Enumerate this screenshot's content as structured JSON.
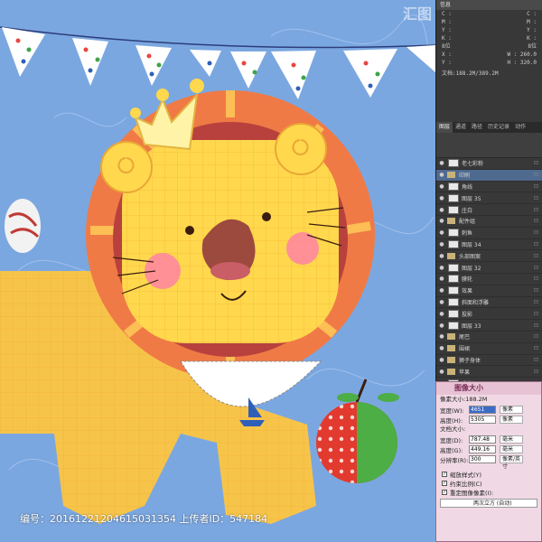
{
  "info": {
    "tab": "信息",
    "rows": [
      [
        "C :",
        "C :"
      ],
      [
        "M :",
        "M :"
      ],
      [
        "Y :",
        "Y :"
      ],
      [
        "K :",
        "K :"
      ],
      [
        "8位",
        "8位"
      ],
      [
        "X :",
        "W :   260.0"
      ],
      [
        "Y :",
        "H :   320.0"
      ]
    ],
    "doc": "文档:188.2M/389.2M"
  },
  "layers": {
    "tabs": [
      "图层",
      "通道",
      "路径",
      "历史记录",
      "动作"
    ],
    "items": [
      {
        "name": "老七彩粉",
        "type": "layer"
      },
      {
        "name": "印刷",
        "type": "group",
        "selected": true
      },
      {
        "name": "角线",
        "type": "layer"
      },
      {
        "name": "图层 35",
        "type": "layer"
      },
      {
        "name": "庄白",
        "type": "layer"
      },
      {
        "name": "配件组",
        "type": "group"
      },
      {
        "name": "刺鱼",
        "type": "layer"
      },
      {
        "name": "图层 34",
        "type": "layer"
      },
      {
        "name": "头部图案",
        "type": "group"
      },
      {
        "name": "图层 32",
        "type": "layer"
      },
      {
        "name": "膜轮",
        "type": "layer"
      },
      {
        "name": "效果",
        "type": "layer"
      },
      {
        "name": "斜面和浮雕",
        "type": "layer"
      },
      {
        "name": "投影",
        "type": "layer"
      },
      {
        "name": "图层 33",
        "type": "layer"
      },
      {
        "name": "尾巴",
        "type": "group"
      },
      {
        "name": "围裙",
        "type": "group"
      },
      {
        "name": "狮子身体",
        "type": "group"
      },
      {
        "name": "苹果",
        "type": "group"
      },
      {
        "name": "投影",
        "type": "layer"
      }
    ]
  },
  "dialog": {
    "title": "图像大小",
    "pixel_dims": "像素大小:188.2M",
    "width_label": "宽度(W):",
    "width_value": "4651",
    "height_label": "高度(H):",
    "height_value": "5305",
    "pixel_unit": "像素",
    "doc_size": "文档大小:",
    "doc_width_label": "宽度(D):",
    "doc_width_value": "787.48",
    "doc_height_label": "高度(G):",
    "doc_height_value": "449.16",
    "mm": "毫米",
    "res_label": "分辨率(R):",
    "res_value": "300",
    "res_unit": "像素/英寸",
    "check_scale": "缩放样式(Y)",
    "check_constrain": "约束比例(C)",
    "check_resample": "重定图像像素(I):",
    "resample_method": "两次立方 (自动)"
  },
  "footer": {
    "text": "编号：20161221204615031354 上传者ID：547184"
  },
  "colors": {
    "background": "#7ba7e0",
    "mane_outer": "#f07a45",
    "mane_inner": "#b8413e",
    "face": "#ffd84d",
    "body": "#f7c44a"
  }
}
